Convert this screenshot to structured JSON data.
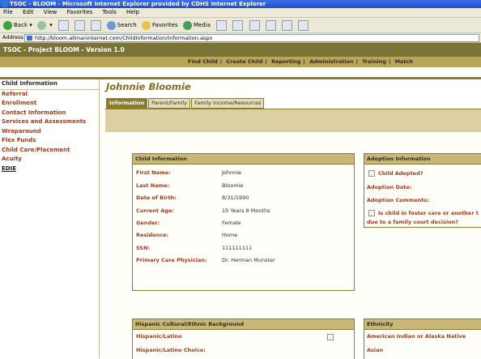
{
  "browser": {
    "title": "TSOC - BLOOM - Microsoft Internet Explorer provided by CDHS Internet Explorer",
    "menu": [
      "File",
      "Edit",
      "View",
      "Favorites",
      "Tools",
      "Help"
    ],
    "toolbar": {
      "back": "Back",
      "search": "Search",
      "favorites": "Favorites",
      "media": "Media"
    },
    "address_label": "Address",
    "address_value": "http://bloom.allmaninternet.com/ChildInformation/Information.aspx"
  },
  "app": {
    "title": "TSOC - Project BLOOM - Version 1.0",
    "topnav": [
      "Find Child",
      "Create Child",
      "Reporting",
      "Administration",
      "Training",
      "Match"
    ]
  },
  "sidebar": {
    "items": [
      "Child Information",
      "Referral",
      "Enrollment",
      "Contact Information",
      "Services and Assessments",
      "Wraparound",
      "Flex Funds",
      "Child Care/Placement",
      "Acuity",
      "EDIE"
    ]
  },
  "main": {
    "child_name": "Johnnie Bloomie",
    "tabs": [
      "Information",
      "Parent/Family",
      "Family Income/Resources"
    ]
  },
  "child_info": {
    "header": "Child Information",
    "rows": [
      {
        "label": "First Name:",
        "value": "Johnnie"
      },
      {
        "label": "Last Name:",
        "value": "Bloomie"
      },
      {
        "label": "Date of Birth:",
        "value": "8/31/1990"
      },
      {
        "label": "Current Age:",
        "value": "15 Years 8 Months"
      },
      {
        "label": "Gender:",
        "value": "Female"
      },
      {
        "label": "Residence:",
        "value": "Home"
      },
      {
        "label": "SSN:",
        "value": "111111111"
      },
      {
        "label": "Primary Care Physician:",
        "value": "Dr. Herman Munster"
      }
    ]
  },
  "adoption": {
    "header": "Adoption Information",
    "child_adopted": "Child Adopted?",
    "adoption_date": "Adoption Date:",
    "adoption_comments": "Adoption Comments:",
    "foster_line1": "Is child in foster care or another t",
    "foster_line2": "due to a family court decision?"
  },
  "hispanic": {
    "header": "Hispanic Cultural/Ethnic Background",
    "row1": "Hispanic/Latino",
    "row2": "Hispanic/Latino Choice:"
  },
  "ethnicity": {
    "header": "Ethnicity",
    "row1": "American Indian or Alaska Native",
    "row2": "Asian"
  }
}
